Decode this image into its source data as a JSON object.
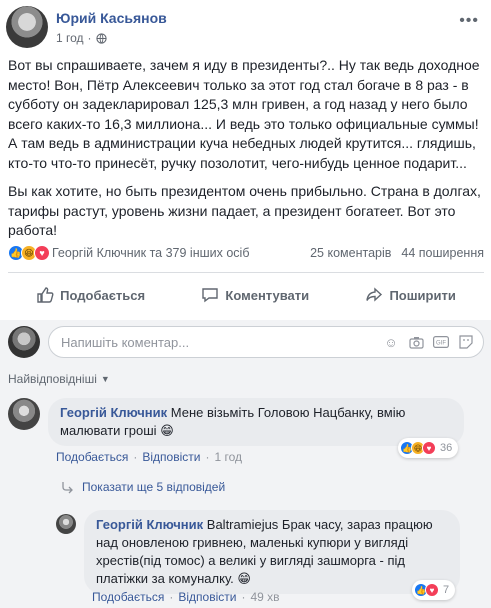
{
  "post": {
    "author": "Юрий Касьянов",
    "time": "1 год",
    "paragraphs": [
      "Вот вы спрашиваете, зачем я иду в президенты?.. Ну так ведь доходное место! Вон, Пётр Алексеевич только за этот год стал богаче в 8 раз - в субботу он задекларировал 125,3 млн гривен, а год назад у него было всего каких-то 16,3 миллиона... И ведь это только официальные суммы! А там ведь в администрации куча небедных людей крутится... глядишь, кто-то что-то принесёт, ручку позолотит, чего-нибудь ценное подарит...",
      "Вы как хотите, но быть президентом очень прибыльно. Страна в долгах, тарифы растут, уровень жизни падает, а президент богатеет. Вот это работа!"
    ],
    "reactions_text": "Георгій Ключник та 379 інших осіб",
    "comments_count": "25 коментарів",
    "shares_count": "44 поширення",
    "actions": {
      "like": "Подобається",
      "comment": "Коментувати",
      "share": "Поширити"
    }
  },
  "composer": {
    "placeholder": "Напишіть коментар..."
  },
  "sort_label": "Найвідповідніші",
  "comments": [
    {
      "author": "Георгій Ключник",
      "text": "Мене візьміть Головою Нацбанку, вмію малювати гроші",
      "emoji": "😁",
      "like_label": "Подобається",
      "reply_label": "Відповісти",
      "time": "1 год",
      "reaction_count": "36"
    }
  ],
  "show_replies": "Показати ще 5 відповідей",
  "replies": [
    {
      "author": "Георгій Ключник",
      "text": "Baltramiejus Брак часу, зараз працюю над оновленою гривнею, маленькі купюри у вигляді хрестів(під томос) а великі у вигляді зашморга - під платіжки за комуналку.",
      "emoji": "😁",
      "like_label": "Подобається",
      "reply_label": "Відповісти",
      "time": "49 хв",
      "reaction_count": "7"
    }
  ],
  "colors": {
    "link": "#385898",
    "like_blue": "#1877f2",
    "love_red": "#f33e58",
    "haha_yellow": "#f7b125",
    "comments_bg": "#f2f3f5"
  }
}
